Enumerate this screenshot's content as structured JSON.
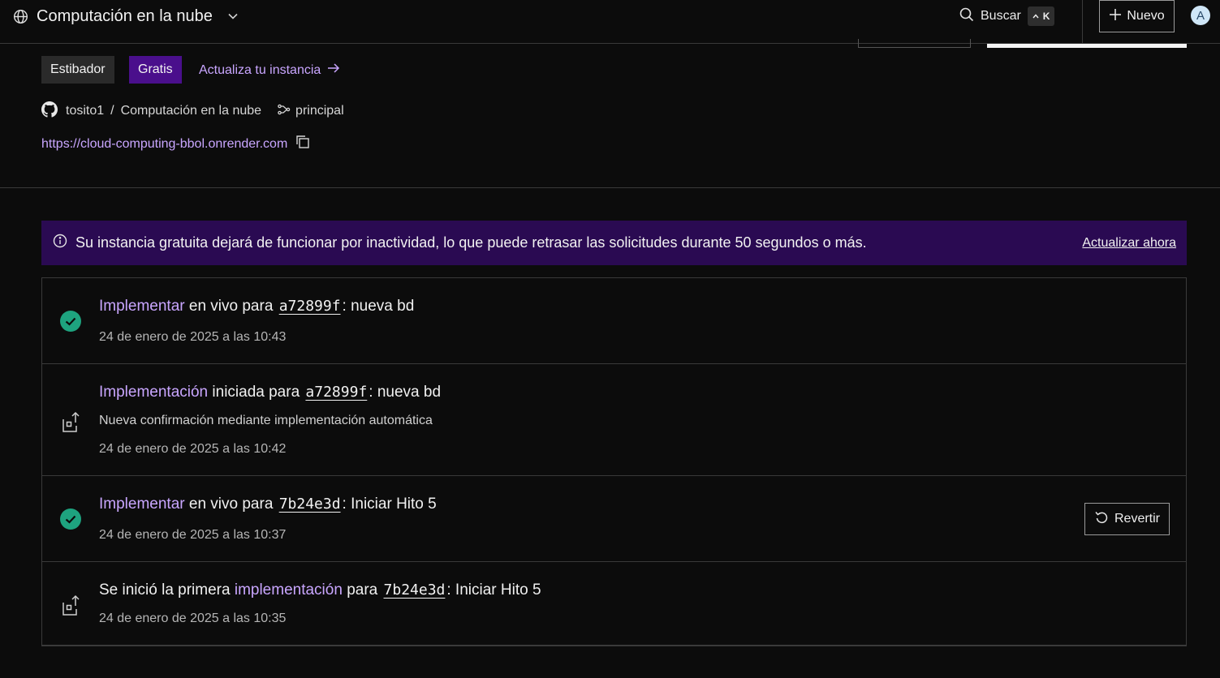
{
  "topbar": {
    "workspace": "Computación en la nube",
    "search_label": "Buscar",
    "search_shortcut_key": "K",
    "new_label": "Nuevo",
    "avatar_initial": "A"
  },
  "service": {
    "type_badge": "Estibador",
    "plan_badge": "Gratis",
    "upgrade_link": "Actualiza tu instancia",
    "repo_owner": "tosito1",
    "repo_sep": "/",
    "repo_name": "Computación en la nube",
    "branch": "principal",
    "url": "https://cloud-computing-bbol.onrender.com"
  },
  "banner": {
    "message": "Su instancia gratuita dejará de funcionar por inactividad, lo que puede retrasar las solicitudes durante 50 segundos o más.",
    "action": "Actualizar ahora"
  },
  "events": [
    {
      "status": "success",
      "prefix": "",
      "link": "Implementar",
      "middle": " en vivo para ",
      "sha": "a72899f",
      "suffix": ": nueva bd",
      "subtitle": "",
      "time": "24 de enero de 2025 a las 10:43"
    },
    {
      "status": "deploy",
      "prefix": "",
      "link": "Implementación",
      "middle": " iniciada para ",
      "sha": "a72899f",
      "suffix": ": nueva bd",
      "subtitle": "Nueva confirmación mediante implementación automática",
      "time": "24 de enero de 2025 a las 10:42"
    },
    {
      "status": "success",
      "prefix": "",
      "link": "Implementar",
      "middle": " en vivo para ",
      "sha": "7b24e3d",
      "suffix": ": Iniciar Hito 5",
      "subtitle": "",
      "time": "24 de enero de 2025 a las 10:37",
      "action": "Revertir"
    },
    {
      "status": "deploy",
      "prefix": "Se inició la primera ",
      "link": "implementación",
      "middle": " para ",
      "sha": "7b24e3d",
      "suffix": ": Iniciar Hito 5",
      "subtitle": "",
      "time": "24 de enero de 2025 a las 10:35"
    }
  ],
  "colors": {
    "accent": "#c9a6ff",
    "plan_badge": "#4a0f8c",
    "banner_bg": "#2a0a52",
    "success": "#1ea37f"
  }
}
